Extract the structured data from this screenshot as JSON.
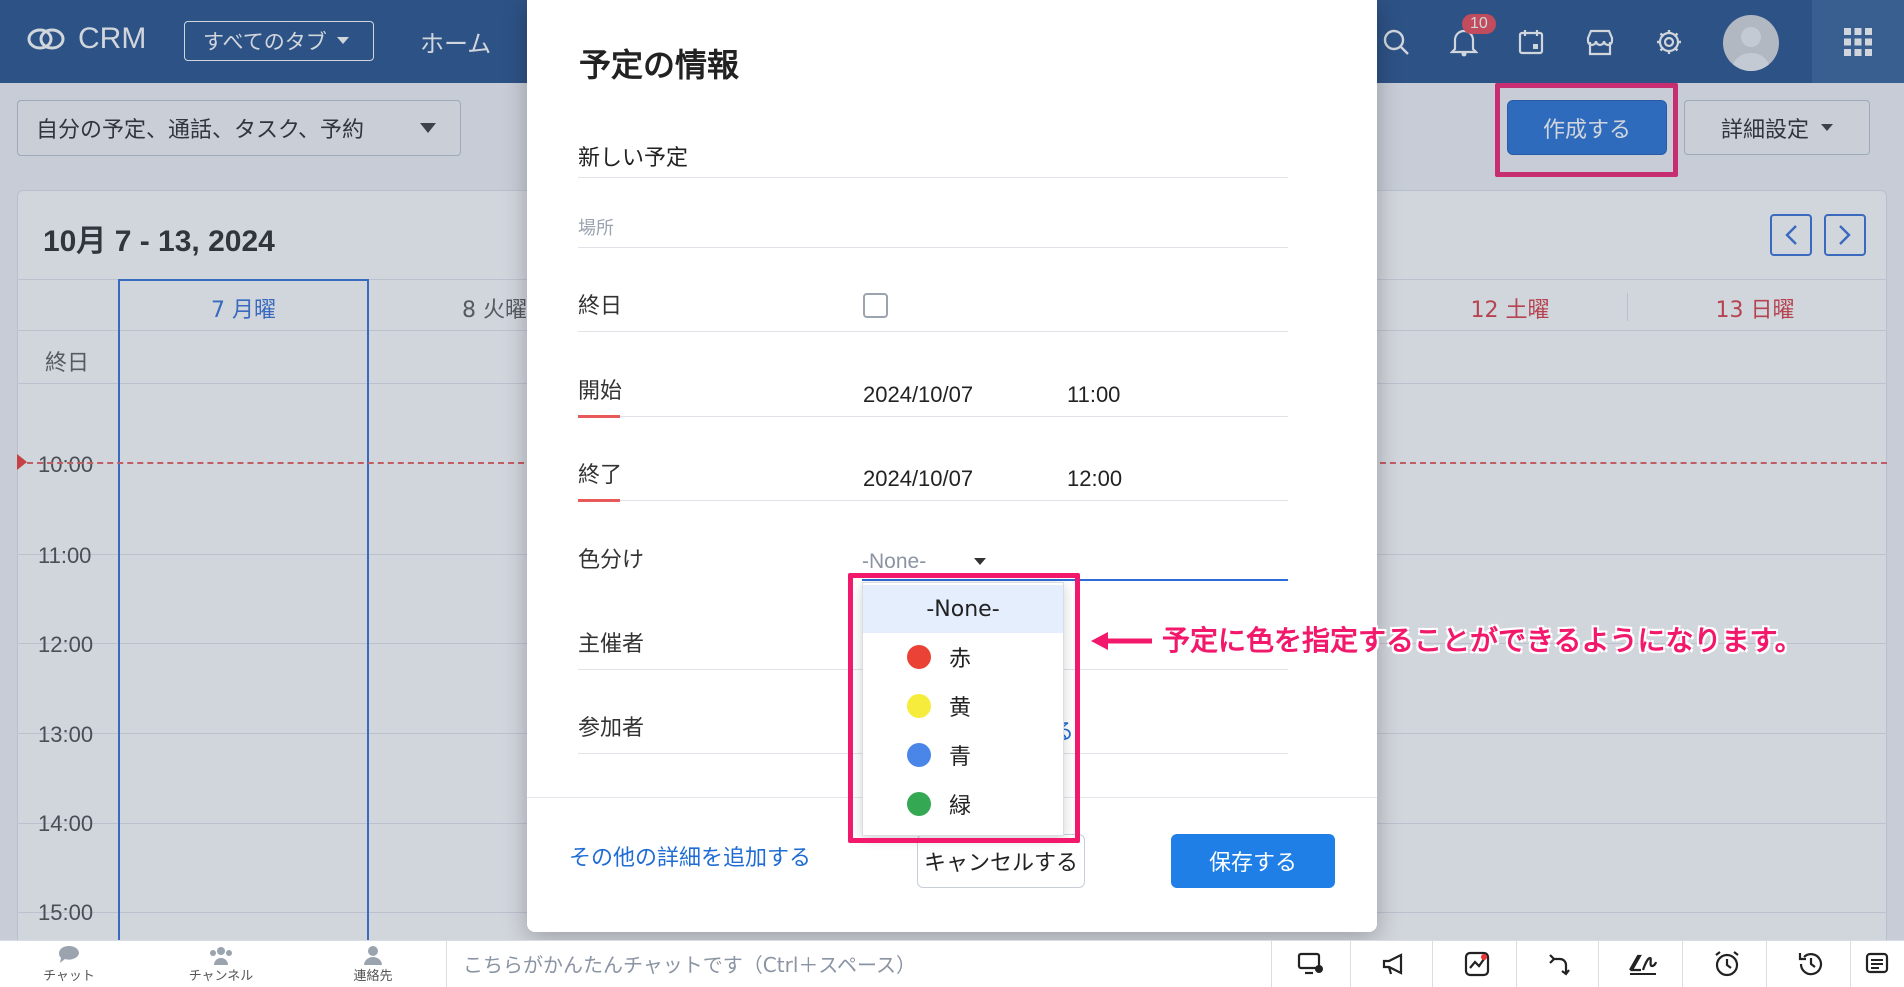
{
  "topbar": {
    "app_name": "CRM",
    "tabs_dropdown": "すべてのタブ",
    "home": "ホーム",
    "notification_count": "10"
  },
  "toolbar": {
    "filter": "自分の予定、通話、タスク、予約",
    "create": "作成する",
    "advanced": "詳細設定"
  },
  "calendar": {
    "range": "10月 7 - 13, 2024",
    "days": [
      {
        "label": "7 月曜",
        "color": "#2d6bd6"
      },
      {
        "label": "8 火曜",
        "color": "#555555"
      },
      {
        "label": "12 土曜",
        "color": "#d9363e"
      },
      {
        "label": "13 日曜",
        "color": "#d9363e"
      }
    ],
    "all_day": "終日",
    "times": [
      "10:00",
      "11:00",
      "12:00",
      "13:00",
      "14:00",
      "15:00"
    ]
  },
  "modal": {
    "title": "予定の情報",
    "event_title": "新しい予定",
    "location_placeholder": "場所",
    "all_day_label": "終日",
    "start_label": "開始",
    "start_date": "2024/10/07",
    "start_time": "11:00",
    "end_label": "終了",
    "end_date": "2024/10/07",
    "end_time": "12:00",
    "color_label": "色分け",
    "color_value": "-None-",
    "host_label": "主催者",
    "participants_label": "参加者",
    "participants_link": "する",
    "more_details": "その他の詳細を追加する",
    "cancel": "キャンセルする",
    "save": "保存する"
  },
  "color_options": [
    {
      "label": "-None-",
      "color": ""
    },
    {
      "label": "赤",
      "color": "#ea4335"
    },
    {
      "label": "黄",
      "color": "#f5ec3b"
    },
    {
      "label": "青",
      "color": "#4a86e8"
    },
    {
      "label": "緑",
      "color": "#34a853"
    }
  ],
  "annotation": "予定に色を指定することができるようになります。",
  "bottombar": {
    "chat": "チャット",
    "channel": "チャンネル",
    "contacts": "連絡先",
    "chat_placeholder": "こちらがかんたんチャットです（Ctrl＋スペース）"
  },
  "colors": {
    "topbar": "#1c4a87",
    "accent": "#1f6cd5",
    "highlight": "#f2186b"
  }
}
